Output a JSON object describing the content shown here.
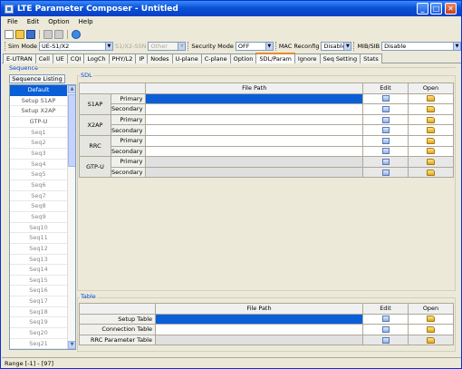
{
  "window": {
    "title": "LTE Parameter Composer - Untitled",
    "min": "_",
    "max": "□",
    "close": "✕"
  },
  "menu": [
    {
      "label": "File"
    },
    {
      "label": "Edit"
    },
    {
      "label": "Option"
    },
    {
      "label": "Help"
    }
  ],
  "toolbar": {
    "icons": [
      "new-icon",
      "open-icon",
      "save-icon",
      "cut-icon",
      "copy-icon",
      "help-icon"
    ]
  },
  "options": {
    "sim_mode_label": "Sim Mode",
    "sim_mode_value": "UE-S1/X2",
    "s1x2ssn_label": "S1/X2-SSN",
    "s1x2ssn_value": "Other",
    "security_label": "Security Mode",
    "security_value": "OFF",
    "mac_label": "MAC Reconfig",
    "mac_value": "Disable",
    "mib_label": "MIB/SIB",
    "mib_value": "Disable"
  },
  "tabs": [
    {
      "label": "E-UTRAN"
    },
    {
      "label": "Cell"
    },
    {
      "label": "UE"
    },
    {
      "label": "CQI"
    },
    {
      "label": "LogCh"
    },
    {
      "label": "PHY/L2"
    },
    {
      "label": "IP"
    },
    {
      "label": "Nodes"
    },
    {
      "label": "U-plane"
    },
    {
      "label": "C-plane"
    },
    {
      "label": "Option"
    },
    {
      "label": "SDL/Param",
      "active": true
    },
    {
      "label": "Ignore"
    },
    {
      "label": "Seq Setting"
    },
    {
      "label": "Stats"
    }
  ],
  "sequence": {
    "header": "Sequence",
    "listing_header": "Sequence Listing",
    "items": [
      "Default",
      "Setup S1AP",
      "Setup X2AP",
      "GTP-U",
      "Seq1",
      "Seq2",
      "Seq3",
      "Seq4",
      "Seq5",
      "Seq6",
      "Seq7",
      "Seq8",
      "Seq9",
      "Seq10",
      "Seq11",
      "Seq12",
      "Seq13",
      "Seq14",
      "Seq15",
      "Seq16",
      "Seq17",
      "Seq18",
      "Seq19",
      "Seq20",
      "Seq21"
    ]
  },
  "sdl": {
    "group_label": "SDL",
    "col_filepath": "File Path",
    "col_edit": "Edit",
    "col_open": "Open",
    "primary": "Primary",
    "secondary": "Secondary",
    "rows": [
      {
        "name": "S1AP"
      },
      {
        "name": "X2AP"
      },
      {
        "name": "RRC"
      },
      {
        "name": "GTP-U"
      }
    ]
  },
  "table": {
    "group_label": "Table",
    "col_filepath": "File Path",
    "col_edit": "Edit",
    "col_open": "Open",
    "rows": [
      {
        "name": "Setup Table"
      },
      {
        "name": "Connection Table"
      },
      {
        "name": "RRC Parameter Table"
      }
    ]
  },
  "status": {
    "text": "Range [-1] - [97]"
  }
}
